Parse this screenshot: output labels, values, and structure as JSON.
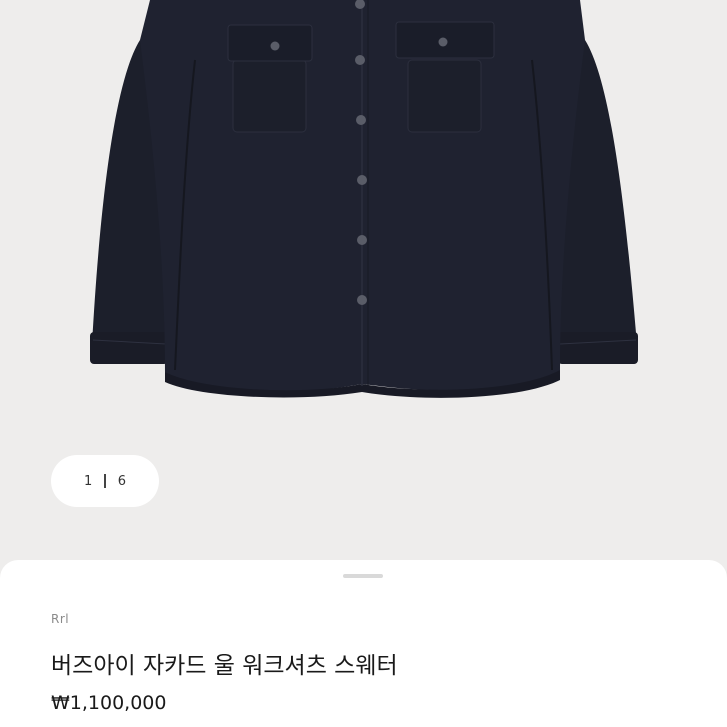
{
  "product": {
    "image_icon": "navy-wool-work-shirt-image",
    "pager": {
      "current": "1",
      "total": "6"
    },
    "brand": "Rrl",
    "title": "버즈아이 자카드 울 워크셔츠 스웨터",
    "price": "₩1,100,000"
  },
  "colors": {
    "garment": "#1c1f2b",
    "background": "#eeedec",
    "sheet": "#ffffff"
  }
}
